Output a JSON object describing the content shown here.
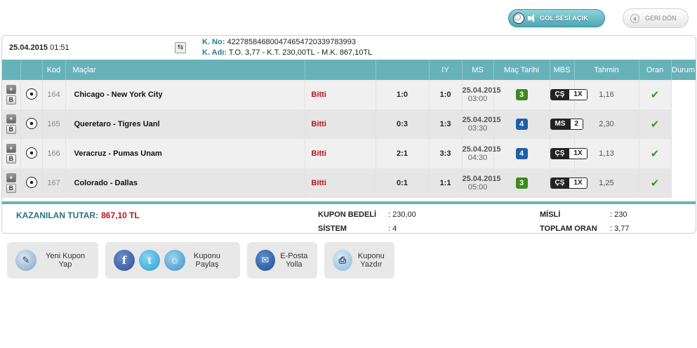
{
  "top": {
    "gol_label": "GOL SESİ AÇIK",
    "geri_label": "GERİ DÖN"
  },
  "info": {
    "date": "25.04.2015",
    "time": "01:51",
    "kno_label": "K. No:",
    "kno_value": "4227858468004746547203397839 93",
    "kadi_label": "K. Adı:",
    "kadi_value": "T.O. 3,77 - K.T. 230,00TL - M.K. 867,10TL"
  },
  "columns": {
    "kod": "Kod",
    "maclar": "Maçlar",
    "iy": "IY",
    "ms": "MS",
    "tarih": "Maç Tarihi",
    "mbs": "MBS",
    "tahmin": "Tahmin",
    "oran": "Oran",
    "durum": "Durum"
  },
  "rows": [
    {
      "kod": "164",
      "match": "Chicago - New York City",
      "status": "Bitti",
      "iy": "1:0",
      "ms": "1:0",
      "date": "25.04.2015",
      "time": "03:00",
      "mbs": "3",
      "mbs_color": "#3c8a1c",
      "tahmin_key": "ÇŞ",
      "tahmin_val": "1X",
      "oran": "1,16",
      "button_b": "B"
    },
    {
      "kod": "165",
      "match": "Queretaro - Tigres Uanl",
      "status": "Bitti",
      "iy": "0:3",
      "ms": "1:3",
      "date": "25.04.2015",
      "time": "03:30",
      "mbs": "4",
      "mbs_color": "#1f5ea8",
      "tahmin_key": "MS",
      "tahmin_val": "2",
      "oran": "2,30",
      "button_b": "B"
    },
    {
      "kod": "166",
      "match": "Veracruz - Pumas Unam",
      "status": "Bitti",
      "iy": "2:1",
      "ms": "3:3",
      "date": "25.04.2015",
      "time": "04:30",
      "mbs": "4",
      "mbs_color": "#1f5ea8",
      "tahmin_key": "ÇŞ",
      "tahmin_val": "1X",
      "oran": "1,13",
      "button_b": "B"
    },
    {
      "kod": "167",
      "match": "Colorado - Dallas",
      "status": "Bitti",
      "iy": "0:1",
      "ms": "1:1",
      "date": "25.04.2015",
      "time": "05:00",
      "mbs": "3",
      "mbs_color": "#3c8a1c",
      "tahmin_key": "ÇŞ",
      "tahmin_val": "1X",
      "oran": "1,25",
      "button_b": "B"
    }
  ],
  "footer": {
    "kazanilan_label": "KAZANILAN TUTAR:",
    "kazanilan_value": "867,10 TL",
    "kupon_bedeli_label": "KUPON BEDELİ",
    "kupon_bedeli_value": ": 230,00",
    "sistem_label": "SİSTEM",
    "sistem_value": ": 4",
    "misli_label": "MİSLİ",
    "misli_value": ": 230",
    "toplam_oran_label": "TOPLAM ORAN",
    "toplam_oran_value": ": 3,77"
  },
  "actions": {
    "yeni_kupon": "Yeni Kupon Yap",
    "kuponu_paylas": "Kuponu Paylaş",
    "eposta": "E-Posta Yolla",
    "kuponu_yazdir": "Kuponu Yazdır"
  },
  "icons": {
    "ball": "soccer-ball-icon",
    "check": "check-icon",
    "refresh": "refresh-icon",
    "stats": "statistics-icon"
  }
}
